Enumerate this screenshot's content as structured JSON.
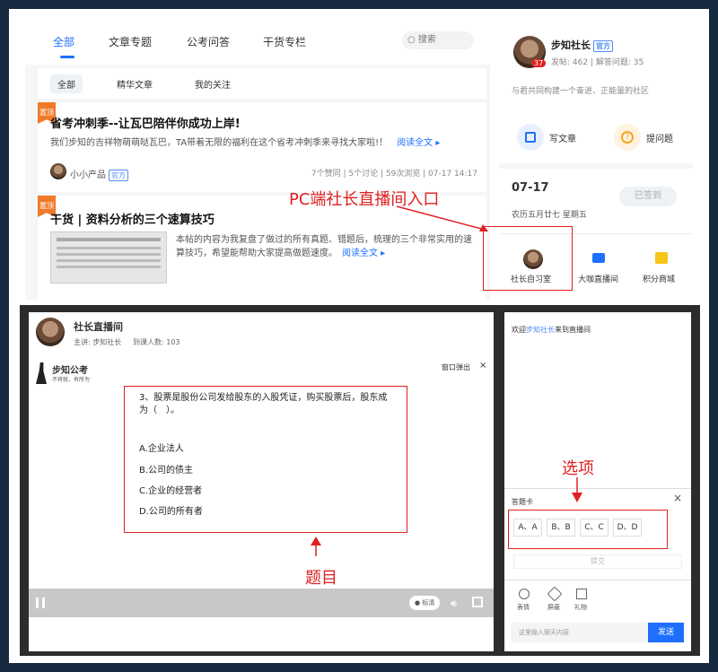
{
  "nav": {
    "tabs": [
      "全部",
      "文章专题",
      "公考问答",
      "干货专栏"
    ],
    "search_placeholder": "搜索"
  },
  "subtabs": [
    "全部",
    "精华文章",
    "我的关注"
  ],
  "posts": [
    {
      "badge": "置顶",
      "title": "省考冲刺季--让瓦巴陪伴你成功上岸!",
      "desc": "我们步知的吉祥物萌萌哒瓦巴，TA带着无限的福利在这个省考冲刺季来寻找大家啦!！",
      "read": "阅读全文 ▸",
      "author": "小小产品",
      "author_tag": "官方",
      "stats": "7个赞同 | 5个讨论 | 59次浏览 | 07-17 14:17"
    },
    {
      "badge": "置顶",
      "title": "干货 | 资料分析的三个速算技巧",
      "desc": "本帖的内容为我复盘了做过的所有真题、错题后，梳理的三个非常实用的速算技巧，希望能帮助大家提高做题速度。",
      "read": "阅读全文 ▸"
    }
  ],
  "profile": {
    "name": "步知社长",
    "tag": "官方",
    "badge_count": "37",
    "stats": "发帖: 462 | 解答问题: 35",
    "slogan": "与君共同构建一个奋进、正能量的社区",
    "write": "写文章",
    "ask": "提问题"
  },
  "calendar": {
    "date": "07-17",
    "lunar": "农历五月廿七 星期五",
    "signed": "已签到"
  },
  "shortcuts": [
    "社长自习室",
    "大咖直播间",
    "积分商城"
  ],
  "annotations": {
    "pc_entry": "PC端社长直播间入口",
    "options": "选项",
    "question": "题目"
  },
  "live": {
    "title": "社长直播间",
    "host": "主讲: 步知社长",
    "count": "到课人数: 103",
    "logo": "步知公考",
    "logo_sub": "不将就，有所为",
    "popout": "窗口弹出",
    "close": "×"
  },
  "question": {
    "stem": "3、股票是股份公司发给股东的入股凭证，购买股票后，股东成为（　）。",
    "options": [
      "A.企业法人",
      "B.公司的债主",
      "C.企业的经营者",
      "D.公司的所有者"
    ]
  },
  "controls": {
    "quality": "● 标清"
  },
  "chat": {
    "welcome_prefix": "欢迎",
    "welcome_name": "步知社长",
    "welcome_suffix": "来到直播间",
    "card_title": "答题卡",
    "card_close": "×",
    "choices": [
      "A、A",
      "B、B",
      "C、C",
      "D、D"
    ],
    "submit": "提交",
    "tools": [
      "表情",
      "屏蔽",
      "礼物"
    ],
    "input_placeholder": "这里输入聊天内容",
    "send": "发送"
  }
}
